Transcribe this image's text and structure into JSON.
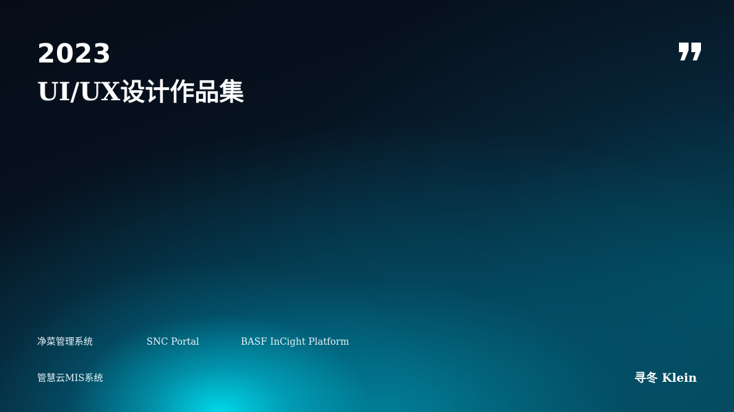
{
  "cover": {
    "year": "2023",
    "title": "UI/UX设计作品集",
    "icon": "quote-icon"
  },
  "projects": [
    {
      "label": "净菜管理系统"
    },
    {
      "label": "SNC Portal"
    },
    {
      "label": "BASF InCight Platform"
    },
    {
      "label": "管慧云MIS系统"
    }
  ],
  "brand": {
    "name": "寻冬 Klein"
  },
  "colors": {
    "background_dark": "#050d17",
    "accent_cyan": "#00dcef",
    "teal": "#0b3b4d",
    "text": "#ffffff"
  }
}
